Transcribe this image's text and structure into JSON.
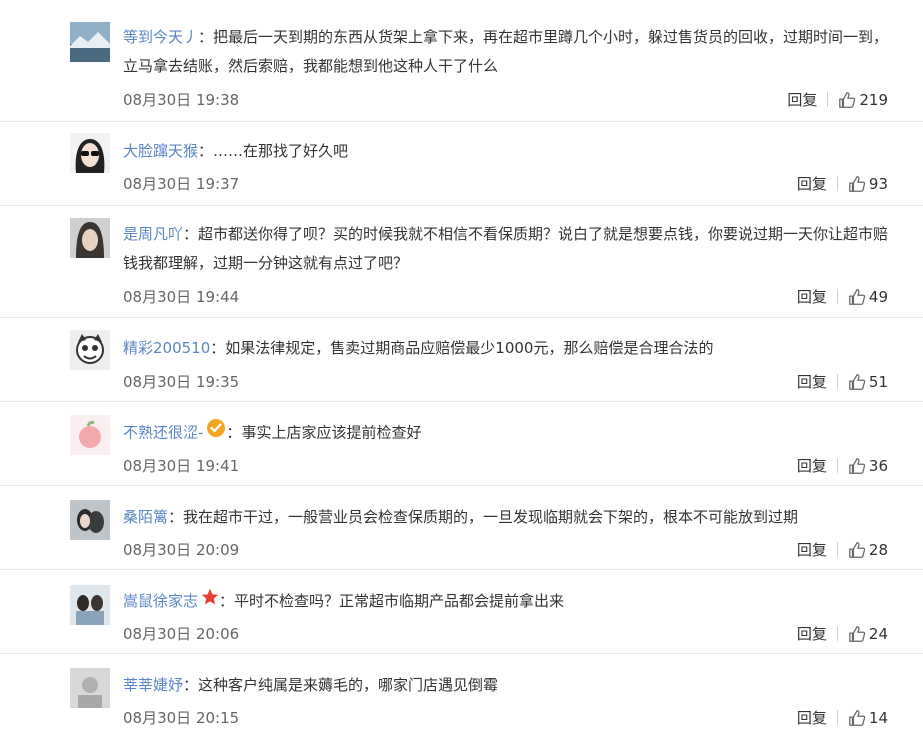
{
  "comments": [
    {
      "name": "等到今天丿",
      "badge": "",
      "text": "把最后一天到期的东西从货架上拿下来，再在超市里蹲几个小时，躲过售货员的回收，过期时间一到，立马拿去结账，然后索赔，我都能想到他这种人干了什么",
      "time": "08月30日 19:38",
      "reply": "回复",
      "likes": "219",
      "avatar": "landscape-avatar"
    },
    {
      "name": "大脸蹿天猴",
      "badge": "",
      "text": "……在那找了好久吧",
      "time": "08月30日 19:37",
      "reply": "回复",
      "likes": "93",
      "avatar": "sunglasses-avatar"
    },
    {
      "name": "是周凡吖",
      "badge": "",
      "text": "超市都送你得了呗？买的时候我就不相信不看保质期？说白了就是想要点钱，你要说过期一天你让超市赔钱我都理解，过期一分钟这就有点过了吧？",
      "time": "08月30日 19:44",
      "reply": "回复",
      "likes": "49",
      "avatar": "portrait-avatar"
    },
    {
      "name": "精彩200510",
      "badge": "",
      "text": "如果法律规定，售卖过期商品应赔偿最少1000元，那么赔偿是合理合法的",
      "time": "08月30日 19:35",
      "reply": "回复",
      "likes": "51",
      "avatar": "cartoon-avatar"
    },
    {
      "name": "不熟还很涩-",
      "badge": "verified",
      "text": "事实上店家应该提前检查好",
      "time": "08月30日 19:41",
      "reply": "回复",
      "likes": "36",
      "avatar": "peach-avatar"
    },
    {
      "name": "桑陌篱",
      "badge": "",
      "text": "我在超市干过，一般营业员会检查保质期的，一旦发现临期就会下架的，根本不可能放到过期",
      "time": "08月30日 20:09",
      "reply": "回复",
      "likes": "28",
      "avatar": "couple-avatar"
    },
    {
      "name": "嵩鼠徐家志",
      "badge": "star",
      "text": "平时不检查吗？正常超市临期产品都会提前拿出来",
      "time": "08月30日 20:06",
      "reply": "回复",
      "likes": "24",
      "avatar": "photo-avatar"
    },
    {
      "name": "莘莘婕妤",
      "badge": "",
      "text": "这种客户纯属是来薅毛的，哪家门店遇见倒霉",
      "time": "08月30日 20:15",
      "reply": "回复",
      "likes": "14",
      "avatar": "gray-avatar"
    }
  ],
  "colors": {
    "name": "#5b86c5",
    "text": "#333333",
    "time": "#666666",
    "divider": "#e6e6e6"
  }
}
